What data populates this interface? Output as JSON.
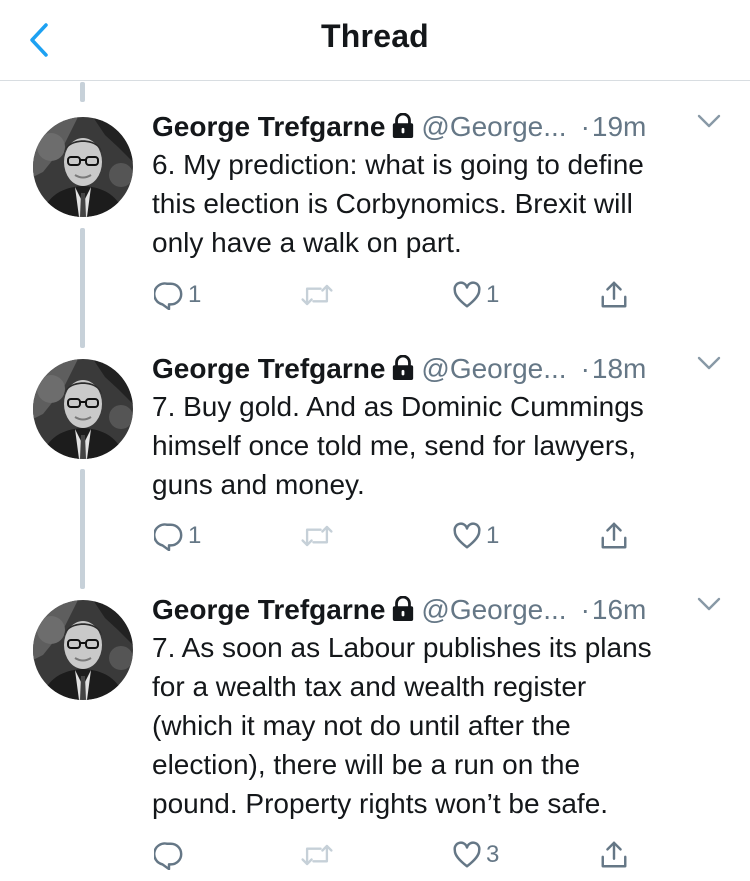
{
  "header": {
    "title": "Thread"
  },
  "colors": {
    "accent": "#1da1f2",
    "secondary_text": "#657786",
    "thread_line": "#c7d1d9"
  },
  "icons": {
    "back": "chevron-left-icon",
    "lock": "lock-icon",
    "caret": "chevron-down-icon",
    "reply": "reply-icon",
    "retweet": "retweet-icon",
    "like": "heart-icon",
    "share": "share-icon"
  },
  "tweets": [
    {
      "name": "George Trefgarne",
      "handle": "@George...",
      "dot": "·",
      "time": "19m",
      "lines": [
        "6. My prediction: what is going to define",
        "this election is Corbynomics. Brexit will",
        "only have a walk on part."
      ],
      "reply_count": "1",
      "retweet_count": "",
      "like_count": "1"
    },
    {
      "name": "George Trefgarne",
      "handle": "@George...",
      "dot": "·",
      "time": "18m",
      "lines": [
        "7. Buy gold. And as Dominic Cummings",
        "himself once told me, send for lawyers,",
        "guns and money."
      ],
      "reply_count": "1",
      "retweet_count": "",
      "like_count": "1"
    },
    {
      "name": "George Trefgarne",
      "handle": "@George...",
      "dot": "·",
      "time": "16m",
      "lines": [
        "7. As soon as Labour publishes its plans",
        "for a wealth tax and wealth register",
        "(which it may not do until after the",
        "election), there will be a run on the",
        "pound. Property rights won’t be safe."
      ],
      "reply_count": "",
      "retweet_count": "",
      "like_count": "3"
    }
  ]
}
